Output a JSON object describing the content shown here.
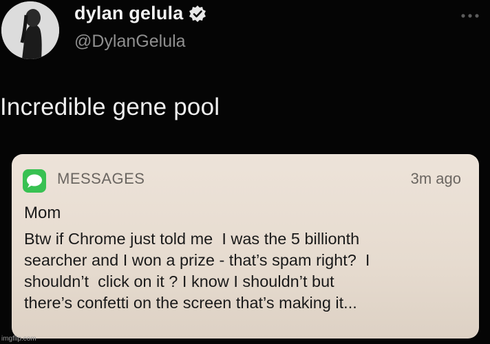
{
  "tweet": {
    "display_name": "dylan gelula",
    "handle": "@DylanGelula",
    "text": "Incredible gene pool",
    "avatar_icon": "profile-photo",
    "verified_icon": "verified-badge-icon",
    "more_icon": "more-options-icon"
  },
  "notification": {
    "app_name": "MESSAGES",
    "app_icon": "messages-app-icon",
    "app_icon_color": "#38c152",
    "time": "3m ago",
    "sender": "Mom",
    "body_lines": [
      "Btw if Chrome just told me  I was the 5 billionth",
      "searcher and I won a prize - that’s spam right?  I",
      "shouldn’t  click on it ? I know I shouldn’t but",
      "there’s confetti on the screen that’s making it..."
    ]
  },
  "watermark": "imgflip.com"
}
